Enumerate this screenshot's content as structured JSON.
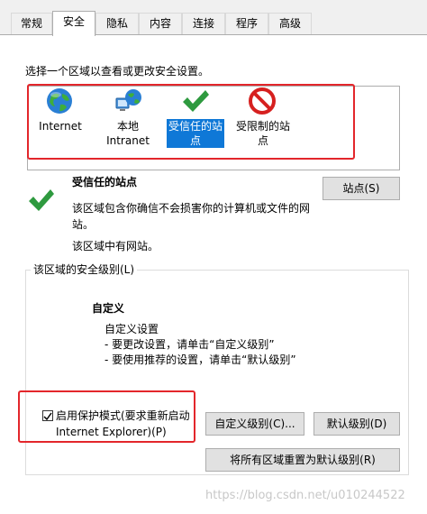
{
  "tabs": [
    {
      "label": "常规",
      "active": false
    },
    {
      "label": "安全",
      "active": true
    },
    {
      "label": "隐私",
      "active": false
    },
    {
      "label": "内容",
      "active": false
    },
    {
      "label": "连接",
      "active": false
    },
    {
      "label": "程序",
      "active": false
    },
    {
      "label": "高级",
      "active": false
    }
  ],
  "zone_prompt": "选择一个区域以查看或更改安全设置。",
  "zones": [
    {
      "icon": "globe-icon",
      "line1": "Internet",
      "line2": ""
    },
    {
      "icon": "local-intranet-icon",
      "line1": "本地",
      "line2": "Intranet"
    },
    {
      "icon": "checkmark-icon",
      "line1": "受信任的站",
      "line2": "点",
      "selected": true
    },
    {
      "icon": "restricted-icon",
      "line1": "受限制的站",
      "line2": "点"
    }
  ],
  "selected_zone": {
    "title": "受信任的站点",
    "desc_line1": "该区域包含你确信不会损害你的计算机或文件的网",
    "desc_line2": "站。",
    "sites_note": "该区域中有网站。"
  },
  "sites_button": "站点(S)",
  "security_level_legend": "该区域的安全级别(L)",
  "custom": {
    "title": "自定义",
    "line1": "自定义设置",
    "line2": "- 要更改设置，请单击“自定义级别”",
    "line3": "- 要使用推荐的设置，请单击“默认级别”"
  },
  "protected_mode": {
    "line1": "启用保护模式(要求重新启动",
    "line2": "Internet Explorer)(P)",
    "checked": true
  },
  "custom_level_button": "自定义级别(C)...",
  "default_level_button": "默认级别(D)",
  "reset_all_button": "将所有区域重置为默认级别(R)",
  "watermark": "https://blog.csdn.net/u010244522",
  "colors": {
    "accent": "#0f78d7",
    "highlight_red": "#e3262b",
    "check_green": "#2e9a3f"
  }
}
